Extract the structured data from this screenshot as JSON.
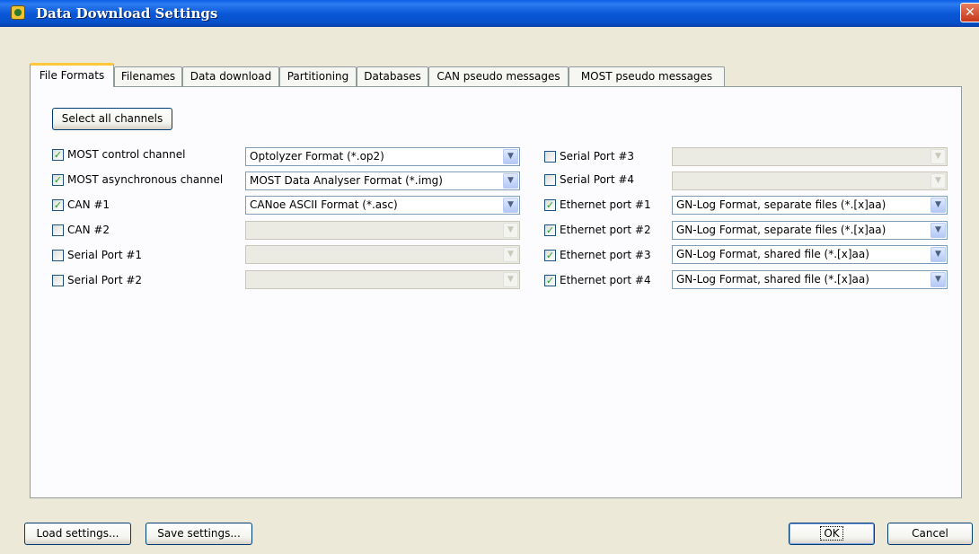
{
  "window": {
    "title": "Data Download Settings",
    "close_glyph": "✕"
  },
  "tabs": [
    {
      "label": "File Formats",
      "active": true
    },
    {
      "label": "Filenames"
    },
    {
      "label": "Data download"
    },
    {
      "label": "Partitioning"
    },
    {
      "label": "Databases"
    },
    {
      "label": "CAN pseudo messages"
    },
    {
      "label": "MOST pseudo messages"
    }
  ],
  "panel": {
    "select_all_label": "Select all channels"
  },
  "left_channels": [
    {
      "label": "MOST control channel",
      "checked": true,
      "format": "Optolyzer Format (*.op2)",
      "enabled": true
    },
    {
      "label": "MOST asynchronous channel",
      "checked": true,
      "format": "MOST Data Analyser Format (*.img)",
      "enabled": true
    },
    {
      "label": "CAN #1",
      "checked": true,
      "format": "CANoe ASCII Format (*.asc)",
      "enabled": true
    },
    {
      "label": "CAN #2",
      "checked": false,
      "format": "",
      "enabled": false
    },
    {
      "label": "Serial Port #1",
      "checked": false,
      "format": "",
      "enabled": false
    },
    {
      "label": "Serial Port #2",
      "checked": false,
      "format": "",
      "enabled": false
    }
  ],
  "right_channels": [
    {
      "label": "Serial Port #3",
      "checked": false,
      "format": "",
      "enabled": false
    },
    {
      "label": "Serial Port #4",
      "checked": false,
      "format": "",
      "enabled": false
    },
    {
      "label": "Ethernet port #1",
      "checked": true,
      "format": "GN-Log Format, separate files (*.[x]aa)",
      "enabled": true
    },
    {
      "label": "Ethernet port #2",
      "checked": true,
      "format": "GN-Log Format, separate files (*.[x]aa)",
      "enabled": true
    },
    {
      "label": "Ethernet port #3",
      "checked": true,
      "format": "GN-Log Format, shared file (*.[x]aa)",
      "enabled": true
    },
    {
      "label": "Ethernet port #4",
      "checked": true,
      "format": "GN-Log Format, shared file (*.[x]aa)",
      "enabled": true
    }
  ],
  "footer": {
    "load_label": "Load settings...",
    "save_label": "Save settings...",
    "ok_label": "OK",
    "cancel_label": "Cancel"
  },
  "icons": {
    "check_glyph": "✓",
    "dropdown_glyph": "▼"
  },
  "colors": {
    "titlebar": "#0a58d8",
    "tab_active_accent": "#ffc83c",
    "check": "#21a121"
  }
}
